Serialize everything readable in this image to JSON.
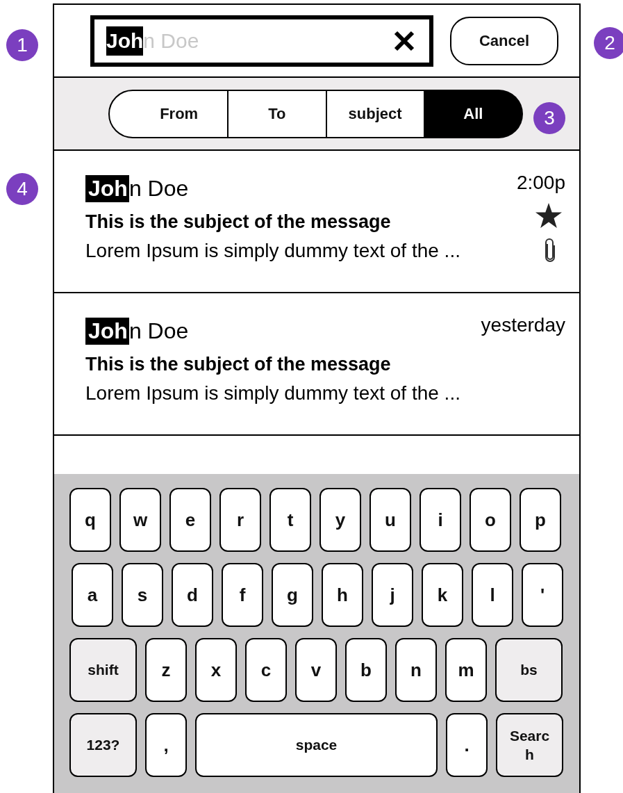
{
  "annotations": [
    {
      "label": "1"
    },
    {
      "label": "2"
    },
    {
      "label": "3"
    },
    {
      "label": "4"
    }
  ],
  "search": {
    "query": "Joh",
    "suggestion": "n Doe"
  },
  "cancel_button": "Cancel",
  "filters": [
    {
      "label": "From",
      "selected": false
    },
    {
      "label": "To",
      "selected": false
    },
    {
      "label": "subject",
      "selected": false
    },
    {
      "label": "All",
      "selected": true
    }
  ],
  "messages": [
    {
      "name_match": "Joh",
      "name_rest": "n Doe",
      "time": "2:00p",
      "subject": "This is the subject of the message",
      "preview": "Lorem Ipsum is simply dummy text of the ...",
      "starred": true,
      "attachment": true
    },
    {
      "name_match": "Joh",
      "name_rest": "n Doe",
      "time": "yesterday",
      "subject": "This is the subject of the message",
      "preview": "Lorem Ipsum is simply dummy text of the ...",
      "starred": false,
      "attachment": false
    }
  ],
  "keyboard": [
    [
      {
        "label": "q",
        "kind": "letter"
      },
      {
        "label": "w",
        "kind": "letter"
      },
      {
        "label": "e",
        "kind": "letter"
      },
      {
        "label": "r",
        "kind": "letter"
      },
      {
        "label": "t",
        "kind": "letter"
      },
      {
        "label": "y",
        "kind": "letter"
      },
      {
        "label": "u",
        "kind": "letter"
      },
      {
        "label": "i",
        "kind": "letter"
      },
      {
        "label": "o",
        "kind": "letter"
      },
      {
        "label": "p",
        "kind": "letter"
      }
    ],
    [
      {
        "label": "a",
        "kind": "letter"
      },
      {
        "label": "s",
        "kind": "letter"
      },
      {
        "label": "d",
        "kind": "letter"
      },
      {
        "label": "f",
        "kind": "letter"
      },
      {
        "label": "g",
        "kind": "letter"
      },
      {
        "label": "h",
        "kind": "letter"
      },
      {
        "label": "j",
        "kind": "letter"
      },
      {
        "label": "k",
        "kind": "letter"
      },
      {
        "label": "l",
        "kind": "letter"
      },
      {
        "label": "'",
        "kind": "letter"
      }
    ],
    [
      {
        "label": "shift",
        "kind": "function"
      },
      {
        "label": "z",
        "kind": "letter"
      },
      {
        "label": "x",
        "kind": "letter"
      },
      {
        "label": "c",
        "kind": "letter"
      },
      {
        "label": "v",
        "kind": "letter"
      },
      {
        "label": "b",
        "kind": "letter"
      },
      {
        "label": "n",
        "kind": "letter"
      },
      {
        "label": "m",
        "kind": "letter"
      },
      {
        "label": "bs",
        "kind": "function"
      }
    ],
    [
      {
        "label": "123?",
        "kind": "function"
      },
      {
        "label": ",",
        "kind": "letter"
      },
      {
        "label": "space",
        "kind": "space"
      },
      {
        "label": ".",
        "kind": "letter"
      },
      {
        "label": "Search",
        "kind": "function"
      }
    ]
  ]
}
